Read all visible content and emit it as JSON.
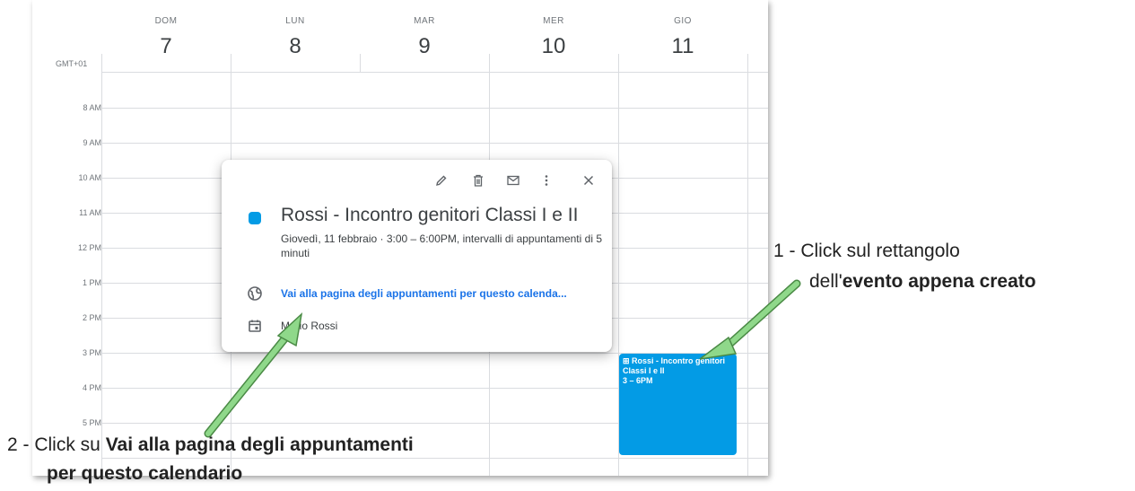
{
  "calendar": {
    "timezone": "GMT+01",
    "days": [
      {
        "name": "DOM",
        "num": "7"
      },
      {
        "name": "LUN",
        "num": "8"
      },
      {
        "name": "MAR",
        "num": "9"
      },
      {
        "name": "MER",
        "num": "10"
      },
      {
        "name": "GIO",
        "num": "11"
      }
    ],
    "hours": [
      "8 AM",
      "9 AM",
      "10 AM",
      "11 AM",
      "12 PM",
      "1 PM",
      "2 PM",
      "3 PM",
      "4 PM",
      "5 PM"
    ],
    "event": {
      "icon": "grid-icon",
      "title": "Rossi - Incontro genitori Classi I e II",
      "time": "3 – 6PM",
      "color": "#039be5"
    }
  },
  "popup": {
    "title": "Rossi - Incontro genitori Classi I e II",
    "date_line": "Giovedì, 11 febbraio  ·  3:00 – 6:00PM, intervalli di appuntamenti di 5 minuti",
    "link_text": "Vai alla pagina degli appuntamenti per questo calenda...",
    "owner": "Mario Rossi",
    "toolbar": [
      "edit-icon",
      "delete-icon",
      "email-icon",
      "more-icon",
      "close-icon"
    ],
    "color": "#039be5",
    "link_color": "#1a73e8"
  },
  "annotations": {
    "a1_line1": "1 - Click sul rettangolo",
    "a1_line2_pre": "dell'",
    "a1_line2_bold": "evento appena creato",
    "a2_line1_pre": "2 - Click su ",
    "a2_line1_bold": "Vai alla pagina degli appuntamenti",
    "a2_line2_bold": "per questo calendario",
    "arrow_color": "#8fd88a"
  }
}
